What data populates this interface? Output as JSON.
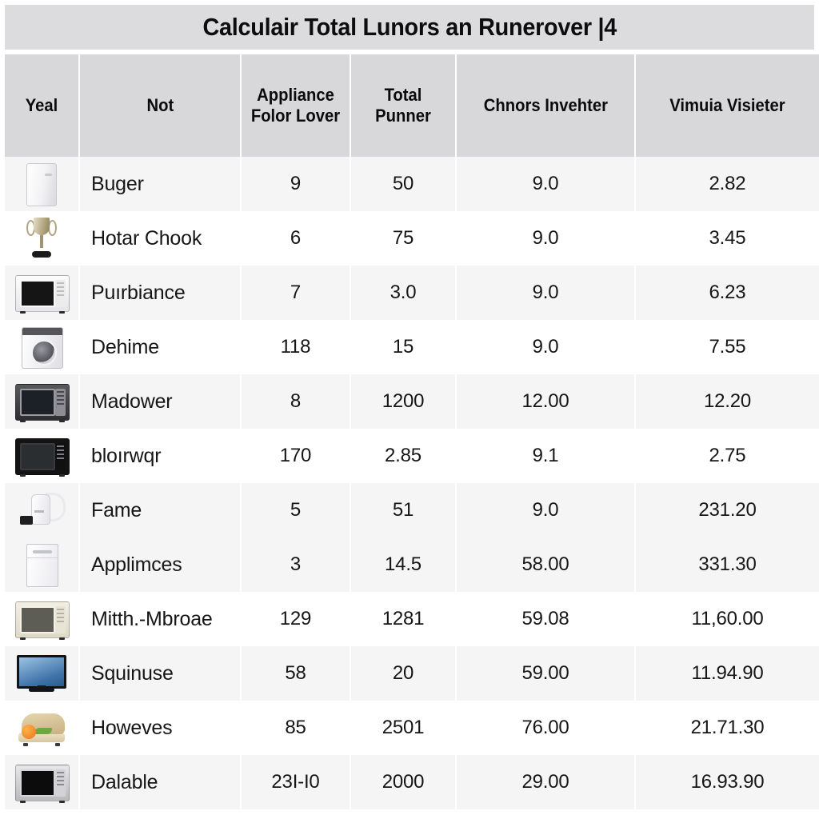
{
  "title": "Calculair Total Lunors an Runerover |4",
  "table": {
    "columns": [
      {
        "key": "icon",
        "label": "Yeal"
      },
      {
        "key": "name",
        "label": "Not"
      },
      {
        "key": "folor",
        "label": "Appliance Folor Lover"
      },
      {
        "key": "punner",
        "label": "Total Punner"
      },
      {
        "key": "chnors",
        "label": "Chnors Invehter"
      },
      {
        "key": "vimuia",
        "label": "Vimuia Visieter"
      }
    ],
    "rows": [
      {
        "icon": "refrigerator-icon",
        "name": "Buger",
        "folor": "9",
        "punner": "50",
        "chnors": "9.0",
        "vimuia": "2.82",
        "shaded": true
      },
      {
        "icon": "trophy-icon",
        "name": "Hotar Chook",
        "folor": "6",
        "punner": "75",
        "chnors": "9.0",
        "vimuia": "3.45",
        "shaded": false
      },
      {
        "icon": "microwave-white-icon",
        "name": "Puırbiance",
        "folor": "7",
        "punner": "3.0",
        "chnors": "9.0",
        "vimuia": "6.23",
        "shaded": true
      },
      {
        "icon": "washing-machine-icon",
        "name": "Dehime",
        "folor": "118",
        "punner": "15",
        "chnors": "9.0",
        "vimuia": "7.55",
        "shaded": false
      },
      {
        "icon": "microwave-silver-icon",
        "name": "Madower",
        "folor": "8",
        "punner": "1200",
        "chnors": "12.00",
        "vimuia": "12.20",
        "shaded": true
      },
      {
        "icon": "microwave-black-icon",
        "name": "bloırwqr",
        "folor": "170",
        "punner": "2.85",
        "chnors": "9.1",
        "vimuia": "2.75",
        "shaded": false
      },
      {
        "icon": "kettle-icon",
        "name": "Fame",
        "folor": "5",
        "punner": "51",
        "chnors": "9.0",
        "vimuia": "231.20",
        "shaded": true
      },
      {
        "icon": "dishwasher-icon",
        "name": "Applimces",
        "folor": "3",
        "punner": "14.5",
        "chnors": "58.00",
        "vimuia": "331.30",
        "shaded": true
      },
      {
        "icon": "microwave-cream-icon",
        "name": "Mitth.-Mbroae",
        "folor": "129",
        "punner": "1281",
        "chnors": "59.08",
        "vimuia": "11,60.00",
        "shaded": false
      },
      {
        "icon": "television-icon",
        "name": "Squinuse",
        "folor": "58",
        "punner": "20",
        "chnors": "59.00",
        "vimuia": "11.94.90",
        "shaded": true
      },
      {
        "icon": "sandwich-icon",
        "name": "Howeves",
        "folor": "85",
        "punner": "2501",
        "chnors": "76.00",
        "vimuia": "21.71.30",
        "shaded": false
      },
      {
        "icon": "microwave-steel-icon",
        "name": "Dalable",
        "folor": "23I-I0",
        "punner": "2000",
        "chnors": "29.00",
        "vimuia": "16.93.90",
        "shaded": true
      }
    ]
  },
  "colors": {
    "title_background": "#dcdcdf",
    "header_background": "#d8d8db",
    "row_shaded": "#f5f5f6",
    "row_plain": "#ffffff",
    "text": "#111111"
  }
}
